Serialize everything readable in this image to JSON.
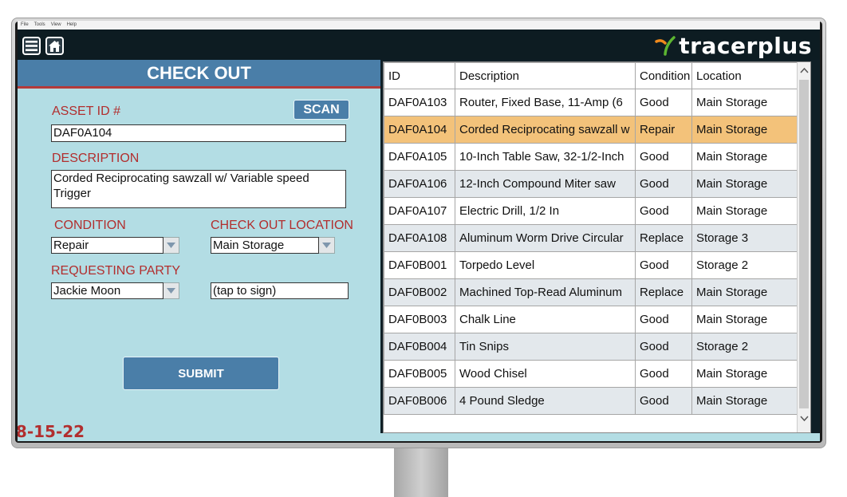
{
  "menubar": {
    "items": [
      "File",
      "Tools",
      "View",
      "Help"
    ]
  },
  "toolbar": {
    "logo_text": "tracerplus",
    "menu_icon": "hamburger-icon",
    "home_icon": "home-icon"
  },
  "form": {
    "title": "CHECK OUT",
    "asset_id_label": "ASSET ID #",
    "asset_id_value": "DAF0A104",
    "scan_label": "SCAN",
    "description_label": "DESCRIPTION",
    "description_value": "Corded Reciprocating sawzall w/ Variable speed Trigger",
    "condition_label": "CONDITION",
    "condition_value": "Repair",
    "location_label": "CHECK OUT LOCATION",
    "location_value": "Main Storage",
    "party_label": "REQUESTING PARTY",
    "party_value": "Jackie Moon",
    "signature_value": "(tap to sign)",
    "submit_label": "SUBMIT",
    "date": "08-15-22"
  },
  "table": {
    "columns": [
      "ID",
      "Description",
      "Condition",
      "Location"
    ],
    "rows": [
      [
        "DAF0A103",
        "Router, Fixed Base, 11-Amp (6",
        "Good",
        "Main Storage"
      ],
      [
        "DAF0A104",
        "Corded Reciprocating sawzall w",
        "Repair",
        "Main Storage"
      ],
      [
        "DAF0A105",
        "10-Inch Table Saw, 32-1/2-Inch",
        "Good",
        "Main Storage"
      ],
      [
        "DAF0A106",
        "12-Inch Compound Miter saw",
        "Good",
        "Main Storage"
      ],
      [
        "DAF0A107",
        "Electric Drill, 1/2 In",
        "Good",
        "Main Storage"
      ],
      [
        "DAF0A108",
        "Aluminum Worm Drive Circular",
        "Replace",
        "Storage 3"
      ],
      [
        "DAF0B001",
        "Torpedo Level",
        "Good",
        "Storage 2"
      ],
      [
        "DAF0B002",
        "Machined Top-Read Aluminum",
        "Replace",
        "Main Storage"
      ],
      [
        "DAF0B003",
        "Chalk Line",
        "Good",
        "Main Storage"
      ],
      [
        "DAF0B004",
        "Tin Snips",
        "Good",
        "Storage 2"
      ],
      [
        "DAF0B005",
        "Wood Chisel",
        "Good",
        "Main Storage"
      ],
      [
        "DAF0B006",
        "4 Pound Sledge",
        "Good",
        "Main Storage"
      ]
    ],
    "selected_row": 1
  },
  "colors": {
    "accent_blue": "#4a7ea8",
    "label_red": "#b22e2e",
    "panel_bg": "#b3dde4",
    "selected_row": "#f3c27a",
    "logo_orange": "#f08a1c",
    "logo_green": "#5cb531"
  }
}
